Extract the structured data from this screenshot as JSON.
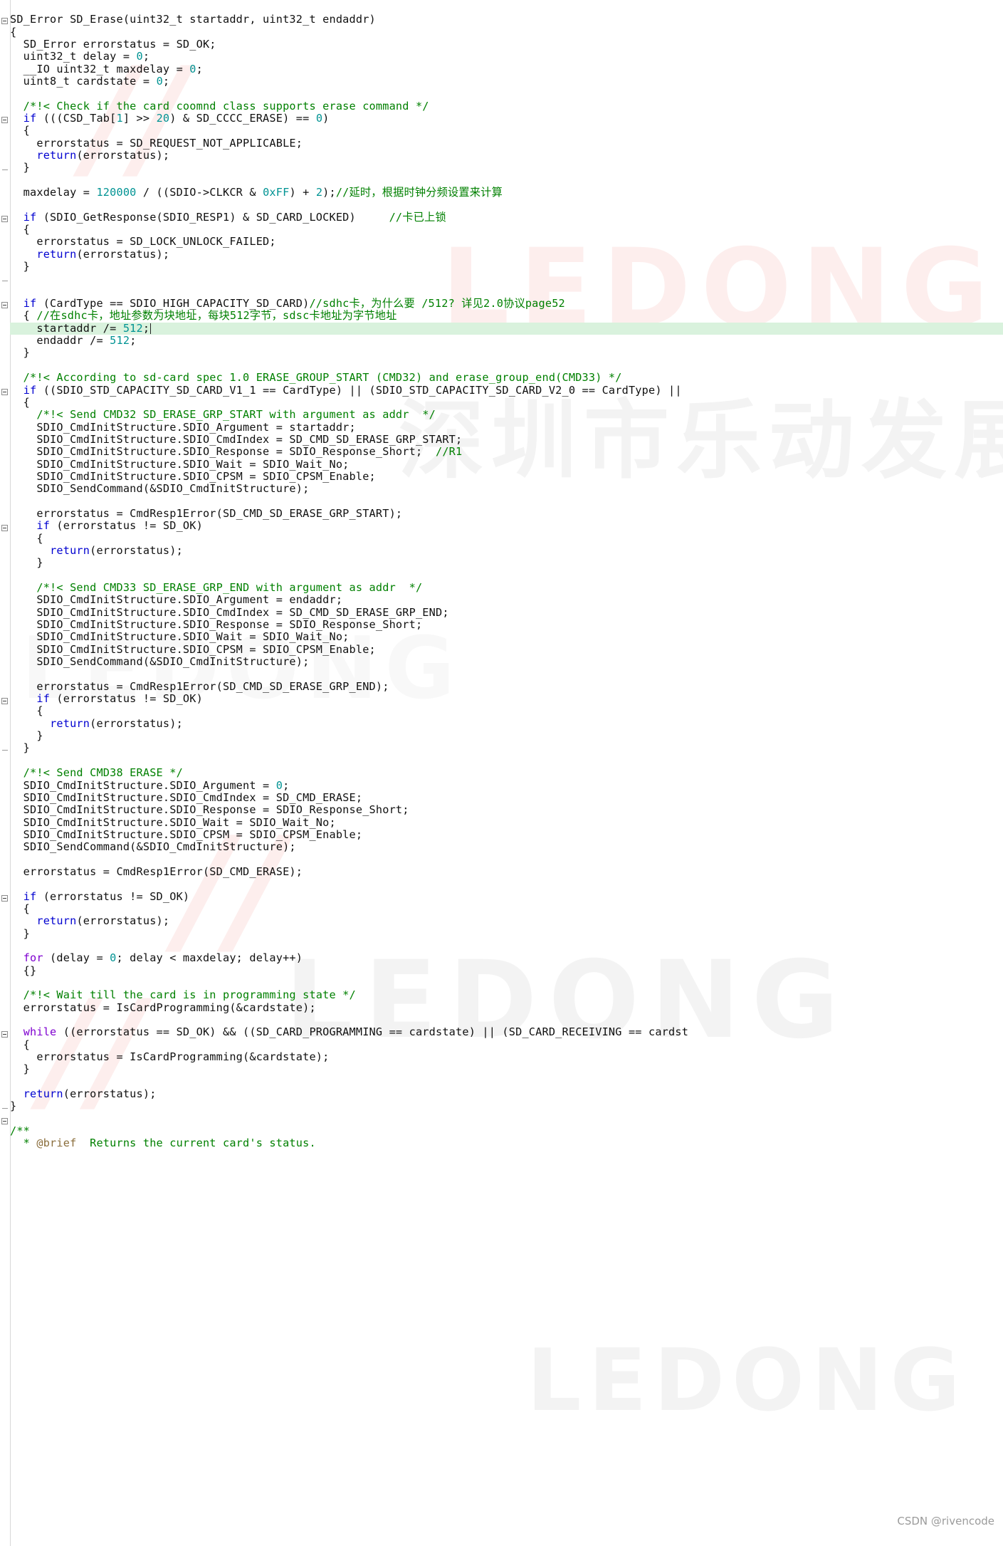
{
  "editor": {
    "language": "c",
    "highlighted_line_index": 27,
    "caret_line_index": 27,
    "colors": {
      "comment": "#008000",
      "keyword": "#0000d0",
      "number": "#009393",
      "text": "#101010",
      "highlight_background": "#d9f2dd",
      "gutter_border": "#d8d8d8",
      "background": "#ffffff"
    }
  },
  "watermarks": {
    "brand_red": "LEDONG",
    "brand_gray": "LEDONG",
    "chinese_company": "深圳市乐动发展有限公司"
  },
  "footer": {
    "attribution": "CSDN @rivencode"
  },
  "code_lines": [
    {
      "indent": 0,
      "tokens": [
        {
          "t": "t",
          "s": "SD_Error SD_Erase(uint32_t startaddr, uint32_t endaddr)"
        }
      ]
    },
    {
      "indent": 0,
      "fold": true,
      "tokens": [
        {
          "t": "t",
          "s": "{"
        }
      ]
    },
    {
      "indent": 0,
      "tokens": [
        {
          "t": "t",
          "s": "  SD_Error errorstatus = SD_OK;"
        }
      ]
    },
    {
      "indent": 0,
      "tokens": [
        {
          "t": "t",
          "s": "  uint32_t delay = "
        },
        {
          "t": "num",
          "s": "0"
        },
        {
          "t": "t",
          "s": ";"
        }
      ]
    },
    {
      "indent": 0,
      "tokens": [
        {
          "t": "t",
          "s": "  __IO uint32_t maxdelay = "
        },
        {
          "t": "num",
          "s": "0"
        },
        {
          "t": "t",
          "s": ";"
        }
      ]
    },
    {
      "indent": 0,
      "tokens": [
        {
          "t": "t",
          "s": "  uint8_t cardstate = "
        },
        {
          "t": "num",
          "s": "0"
        },
        {
          "t": "t",
          "s": ";"
        }
      ]
    },
    {
      "indent": 0,
      "tokens": []
    },
    {
      "indent": 0,
      "tokens": [
        {
          "t": "c",
          "s": "  /*!< Check if the card coomnd class supports erase command */"
        }
      ]
    },
    {
      "indent": 0,
      "tokens": [
        {
          "t": "t",
          "s": "  "
        },
        {
          "t": "kw",
          "s": "if"
        },
        {
          "t": "t",
          "s": " (((CSD_Tab["
        },
        {
          "t": "num",
          "s": "1"
        },
        {
          "t": "t",
          "s": "] >> "
        },
        {
          "t": "num",
          "s": "20"
        },
        {
          "t": "t",
          "s": ") & SD_CCCC_ERASE) == "
        },
        {
          "t": "num",
          "s": "0"
        },
        {
          "t": "t",
          "s": ")"
        }
      ]
    },
    {
      "indent": 0,
      "fold": true,
      "tokens": [
        {
          "t": "t",
          "s": "  {"
        }
      ]
    },
    {
      "indent": 0,
      "tokens": [
        {
          "t": "t",
          "s": "    errorstatus = SD_REQUEST_NOT_APPLICABLE;"
        }
      ]
    },
    {
      "indent": 0,
      "tokens": [
        {
          "t": "t",
          "s": "    "
        },
        {
          "t": "kw",
          "s": "return"
        },
        {
          "t": "t",
          "s": "(errorstatus);"
        }
      ]
    },
    {
      "indent": 0,
      "tokens": [
        {
          "t": "t",
          "s": "  }"
        }
      ]
    },
    {
      "indent": 0,
      "tick": true,
      "tokens": []
    },
    {
      "indent": 0,
      "tokens": [
        {
          "t": "t",
          "s": "  maxdelay = "
        },
        {
          "t": "num",
          "s": "120000"
        },
        {
          "t": "t",
          "s": " / ((SDIO->CLKCR & "
        },
        {
          "t": "num",
          "s": "0xFF"
        },
        {
          "t": "t",
          "s": ") + "
        },
        {
          "t": "num",
          "s": "2"
        },
        {
          "t": "t",
          "s": ");"
        },
        {
          "t": "c",
          "s": "//延时，根据时钟分频设置来计算"
        }
      ]
    },
    {
      "indent": 0,
      "tokens": []
    },
    {
      "indent": 0,
      "tokens": [
        {
          "t": "t",
          "s": "  "
        },
        {
          "t": "kw",
          "s": "if"
        },
        {
          "t": "t",
          "s": " (SDIO_GetResponse(SDIO_RESP1) & SD_CARD_LOCKED)     "
        },
        {
          "t": "c",
          "s": "//卡已上锁"
        }
      ]
    },
    {
      "indent": 0,
      "fold": true,
      "tokens": [
        {
          "t": "t",
          "s": "  {"
        }
      ]
    },
    {
      "indent": 0,
      "tokens": [
        {
          "t": "t",
          "s": "    errorstatus = SD_LOCK_UNLOCK_FAILED;"
        }
      ]
    },
    {
      "indent": 0,
      "tokens": [
        {
          "t": "t",
          "s": "    "
        },
        {
          "t": "kw",
          "s": "return"
        },
        {
          "t": "t",
          "s": "(errorstatus);"
        }
      ]
    },
    {
      "indent": 0,
      "tokens": [
        {
          "t": "t",
          "s": "  }"
        }
      ]
    },
    {
      "indent": 0,
      "tokens": []
    },
    {
      "indent": 0,
      "tick": true,
      "tokens": []
    },
    {
      "indent": 0,
      "tokens": [
        {
          "t": "t",
          "s": "  "
        },
        {
          "t": "kw",
          "s": "if"
        },
        {
          "t": "t",
          "s": " (CardType == SDIO_HIGH_CAPACITY_SD_CARD)"
        },
        {
          "t": "c",
          "s": "//sdhc卡，为什么要 /512? 详见2.0协议page52"
        }
      ]
    },
    {
      "indent": 0,
      "fold": true,
      "tokens": [
        {
          "t": "t",
          "s": "  { "
        },
        {
          "t": "c",
          "s": "//在sdhc卡，地址参数为块地址，每块512字节，sdsc卡地址为字节地址"
        }
      ]
    },
    {
      "indent": 0,
      "hl": true,
      "caret": true,
      "tokens": [
        {
          "t": "t",
          "s": "    startaddr /= "
        },
        {
          "t": "num",
          "s": "512"
        },
        {
          "t": "t",
          "s": ";"
        }
      ]
    },
    {
      "indent": 0,
      "tokens": [
        {
          "t": "t",
          "s": "    endaddr /= "
        },
        {
          "t": "num",
          "s": "512"
        },
        {
          "t": "t",
          "s": ";"
        }
      ]
    },
    {
      "indent": 0,
      "tokens": [
        {
          "t": "t",
          "s": "  }"
        }
      ]
    },
    {
      "indent": 0,
      "tokens": []
    },
    {
      "indent": 0,
      "tokens": [
        {
          "t": "c",
          "s": "  /*!< According to sd-card spec 1.0 ERASE_GROUP_START (CMD32) and erase_group_end(CMD33) */"
        }
      ]
    },
    {
      "indent": 0,
      "tokens": [
        {
          "t": "t",
          "s": "  "
        },
        {
          "t": "kw",
          "s": "if"
        },
        {
          "t": "t",
          "s": " ((SDIO_STD_CAPACITY_SD_CARD_V1_1 == CardType) || (SDIO_STD_CAPACITY_SD_CARD_V2_0 == CardType) ||"
        }
      ]
    },
    {
      "indent": 0,
      "fold": true,
      "tokens": [
        {
          "t": "t",
          "s": "  {"
        }
      ]
    },
    {
      "indent": 0,
      "tokens": [
        {
          "t": "c",
          "s": "    /*!< Send CMD32 SD_ERASE_GRP_START with argument as addr  */"
        }
      ]
    },
    {
      "indent": 0,
      "tokens": [
        {
          "t": "t",
          "s": "    SDIO_CmdInitStructure.SDIO_Argument = startaddr;"
        }
      ]
    },
    {
      "indent": 0,
      "tokens": [
        {
          "t": "t",
          "s": "    SDIO_CmdInitStructure.SDIO_CmdIndex = SD_CMD_SD_ERASE_GRP_START;"
        }
      ]
    },
    {
      "indent": 0,
      "tokens": [
        {
          "t": "t",
          "s": "    SDIO_CmdInitStructure.SDIO_Response = SDIO_Response_Short;  "
        },
        {
          "t": "c",
          "s": "//R1"
        }
      ]
    },
    {
      "indent": 0,
      "tokens": [
        {
          "t": "t",
          "s": "    SDIO_CmdInitStructure.SDIO_Wait = SDIO_Wait_No;"
        }
      ]
    },
    {
      "indent": 0,
      "tokens": [
        {
          "t": "t",
          "s": "    SDIO_CmdInitStructure.SDIO_CPSM = SDIO_CPSM_Enable;"
        }
      ]
    },
    {
      "indent": 0,
      "tokens": [
        {
          "t": "t",
          "s": "    SDIO_SendCommand(&SDIO_CmdInitStructure);"
        }
      ]
    },
    {
      "indent": 0,
      "tokens": []
    },
    {
      "indent": 0,
      "tokens": [
        {
          "t": "t",
          "s": "    errorstatus = CmdResp1Error(SD_CMD_SD_ERASE_GRP_START);"
        }
      ]
    },
    {
      "indent": 0,
      "tokens": [
        {
          "t": "t",
          "s": "    "
        },
        {
          "t": "kw",
          "s": "if"
        },
        {
          "t": "t",
          "s": " (errorstatus != SD_OK)"
        }
      ]
    },
    {
      "indent": 0,
      "fold": true,
      "tokens": [
        {
          "t": "t",
          "s": "    {"
        }
      ]
    },
    {
      "indent": 0,
      "tokens": [
        {
          "t": "t",
          "s": "      "
        },
        {
          "t": "kw",
          "s": "return"
        },
        {
          "t": "t",
          "s": "(errorstatus);"
        }
      ]
    },
    {
      "indent": 0,
      "tokens": [
        {
          "t": "t",
          "s": "    }"
        }
      ]
    },
    {
      "indent": 0,
      "tokens": []
    },
    {
      "indent": 0,
      "tokens": [
        {
          "t": "c",
          "s": "    /*!< Send CMD33 SD_ERASE_GRP_END with argument as addr  */"
        }
      ]
    },
    {
      "indent": 0,
      "tokens": [
        {
          "t": "t",
          "s": "    SDIO_CmdInitStructure.SDIO_Argument = endaddr;"
        }
      ]
    },
    {
      "indent": 0,
      "tokens": [
        {
          "t": "t",
          "s": "    SDIO_CmdInitStructure.SDIO_CmdIndex = SD_CMD_SD_ERASE_GRP_END;"
        }
      ]
    },
    {
      "indent": 0,
      "tokens": [
        {
          "t": "t",
          "s": "    SDIO_CmdInitStructure.SDIO_Response = SDIO_Response_Short;"
        }
      ]
    },
    {
      "indent": 0,
      "tokens": [
        {
          "t": "t",
          "s": "    SDIO_CmdInitStructure.SDIO_Wait = SDIO_Wait_No;"
        }
      ]
    },
    {
      "indent": 0,
      "tokens": [
        {
          "t": "t",
          "s": "    SDIO_CmdInitStructure.SDIO_CPSM = SDIO_CPSM_Enable;"
        }
      ]
    },
    {
      "indent": 0,
      "tokens": [
        {
          "t": "t",
          "s": "    SDIO_SendCommand(&SDIO_CmdInitStructure);"
        }
      ]
    },
    {
      "indent": 0,
      "tokens": []
    },
    {
      "indent": 0,
      "tokens": [
        {
          "t": "t",
          "s": "    errorstatus = CmdResp1Error(SD_CMD_SD_ERASE_GRP_END);"
        }
      ]
    },
    {
      "indent": 0,
      "tokens": [
        {
          "t": "t",
          "s": "    "
        },
        {
          "t": "kw",
          "s": "if"
        },
        {
          "t": "t",
          "s": " (errorstatus != SD_OK)"
        }
      ]
    },
    {
      "indent": 0,
      "fold": true,
      "tokens": [
        {
          "t": "t",
          "s": "    {"
        }
      ]
    },
    {
      "indent": 0,
      "tokens": [
        {
          "t": "t",
          "s": "      "
        },
        {
          "t": "kw",
          "s": "return"
        },
        {
          "t": "t",
          "s": "(errorstatus);"
        }
      ]
    },
    {
      "indent": 0,
      "tokens": [
        {
          "t": "t",
          "s": "    }"
        }
      ]
    },
    {
      "indent": 0,
      "tokens": [
        {
          "t": "t",
          "s": "  }"
        }
      ]
    },
    {
      "indent": 0,
      "tick": true,
      "tokens": []
    },
    {
      "indent": 0,
      "tokens": [
        {
          "t": "c",
          "s": "  /*!< Send CMD38 ERASE */"
        }
      ]
    },
    {
      "indent": 0,
      "tokens": [
        {
          "t": "t",
          "s": "  SDIO_CmdInitStructure.SDIO_Argument = "
        },
        {
          "t": "num",
          "s": "0"
        },
        {
          "t": "t",
          "s": ";"
        }
      ]
    },
    {
      "indent": 0,
      "tokens": [
        {
          "t": "t",
          "s": "  SDIO_CmdInitStructure.SDIO_CmdIndex = SD_CMD_ERASE;"
        }
      ]
    },
    {
      "indent": 0,
      "tokens": [
        {
          "t": "t",
          "s": "  SDIO_CmdInitStructure.SDIO_Response = SDIO_Response_Short;"
        }
      ]
    },
    {
      "indent": 0,
      "tokens": [
        {
          "t": "t",
          "s": "  SDIO_CmdInitStructure.SDIO_Wait = SDIO_Wait_No;"
        }
      ]
    },
    {
      "indent": 0,
      "tokens": [
        {
          "t": "t",
          "s": "  SDIO_CmdInitStructure.SDIO_CPSM = SDIO_CPSM_Enable;"
        }
      ]
    },
    {
      "indent": 0,
      "tokens": [
        {
          "t": "t",
          "s": "  SDIO_SendCommand(&SDIO_CmdInitStructure);"
        }
      ]
    },
    {
      "indent": 0,
      "tokens": []
    },
    {
      "indent": 0,
      "tokens": [
        {
          "t": "t",
          "s": "  errorstatus = CmdResp1Error(SD_CMD_ERASE);"
        }
      ]
    },
    {
      "indent": 0,
      "tokens": []
    },
    {
      "indent": 0,
      "tokens": [
        {
          "t": "t",
          "s": "  "
        },
        {
          "t": "kw",
          "s": "if"
        },
        {
          "t": "t",
          "s": " (errorstatus != SD_OK)"
        }
      ]
    },
    {
      "indent": 0,
      "fold": true,
      "tokens": [
        {
          "t": "t",
          "s": "  {"
        }
      ]
    },
    {
      "indent": 0,
      "tokens": [
        {
          "t": "t",
          "s": "    "
        },
        {
          "t": "kw",
          "s": "return"
        },
        {
          "t": "t",
          "s": "(errorstatus);"
        }
      ]
    },
    {
      "indent": 0,
      "tokens": [
        {
          "t": "t",
          "s": "  }"
        }
      ]
    },
    {
      "indent": 0,
      "tokens": []
    },
    {
      "indent": 0,
      "tokens": [
        {
          "t": "t",
          "s": "  "
        },
        {
          "t": "kwv",
          "s": "for"
        },
        {
          "t": "t",
          "s": " (delay = "
        },
        {
          "t": "num",
          "s": "0"
        },
        {
          "t": "t",
          "s": "; delay < maxdelay; delay++)"
        }
      ]
    },
    {
      "indent": 0,
      "tokens": [
        {
          "t": "t",
          "s": "  {}"
        }
      ]
    },
    {
      "indent": 0,
      "tokens": []
    },
    {
      "indent": 0,
      "tokens": [
        {
          "t": "c",
          "s": "  /*!< Wait till the card is in programming state */"
        }
      ]
    },
    {
      "indent": 0,
      "tokens": [
        {
          "t": "t",
          "s": "  errorstatus = IsCardProgramming(&cardstate);"
        }
      ]
    },
    {
      "indent": 0,
      "tokens": []
    },
    {
      "indent": 0,
      "tokens": [
        {
          "t": "t",
          "s": "  "
        },
        {
          "t": "kwv",
          "s": "while"
        },
        {
          "t": "t",
          "s": " ((errorstatus == SD_OK) && ((SD_CARD_PROGRAMMING == cardstate) || (SD_CARD_RECEIVING == cardst"
        }
      ]
    },
    {
      "indent": 0,
      "fold": true,
      "tokens": [
        {
          "t": "t",
          "s": "  {"
        }
      ]
    },
    {
      "indent": 0,
      "tokens": [
        {
          "t": "t",
          "s": "    errorstatus = IsCardProgramming(&cardstate);"
        }
      ]
    },
    {
      "indent": 0,
      "tokens": [
        {
          "t": "t",
          "s": "  }"
        }
      ]
    },
    {
      "indent": 0,
      "tokens": []
    },
    {
      "indent": 0,
      "tokens": [
        {
          "t": "t",
          "s": "  "
        },
        {
          "t": "kw",
          "s": "return"
        },
        {
          "t": "t",
          "s": "(errorstatus);"
        }
      ]
    },
    {
      "indent": 0,
      "tokens": [
        {
          "t": "t",
          "s": "}"
        }
      ]
    },
    {
      "indent": 0,
      "tick": true,
      "tokens": []
    },
    {
      "indent": 0,
      "fold": true,
      "tokens": [
        {
          "t": "c",
          "s": "/**"
        }
      ]
    },
    {
      "indent": 0,
      "tokens": [
        {
          "t": "c",
          "s": "  * "
        },
        {
          "t": "cb",
          "s": "@brief"
        },
        {
          "t": "c",
          "s": "  Returns the current card's status."
        }
      ]
    }
  ]
}
